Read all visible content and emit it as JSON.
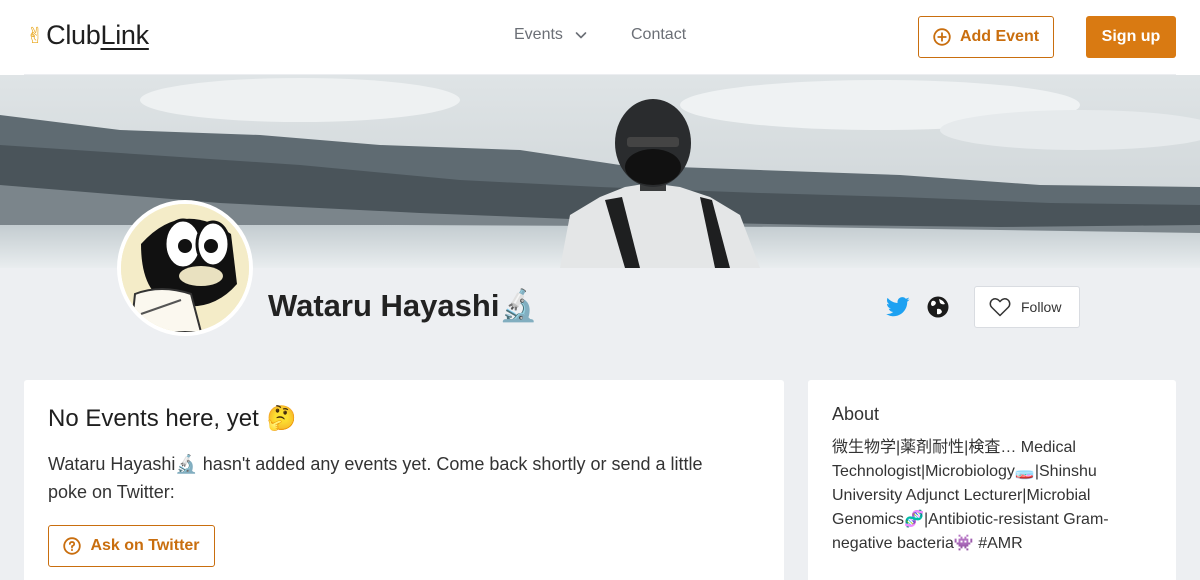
{
  "header": {
    "logo_text_1": "Club",
    "logo_text_2": "Link",
    "nav_events": "Events",
    "nav_contact": "Contact",
    "add_event": "Add Event",
    "sign_up": "Sign up"
  },
  "profile": {
    "name": "Wataru Hayashi🔬",
    "follow_label": "Follow"
  },
  "events_card": {
    "title": "No Events here, yet",
    "title_emoji": "🤔",
    "body": "Wataru Hayashi🔬 hasn't added any events yet. Come back shortly or send a little poke on Twitter:",
    "ask_button": "Ask on Twitter"
  },
  "about_card": {
    "title": "About",
    "body": "微生物学|薬剤耐性|検査… Medical Technologist|Microbiology🧫|Shinshu University Adjunct Lecturer|Microbial Genomics🧬|Antibiotic-resistant Gram-negative bacteria👾 #AMR"
  },
  "colors": {
    "accent": "#d97a12",
    "accent_dark": "#c96e0e",
    "twitter": "#1da1f2",
    "background": "#edeff2"
  },
  "icons": [
    "peace-hand-icon",
    "chevron-down-icon",
    "plus-circle-icon",
    "twitter-icon",
    "globe-icon",
    "heart-icon",
    "question-circle-icon"
  ]
}
